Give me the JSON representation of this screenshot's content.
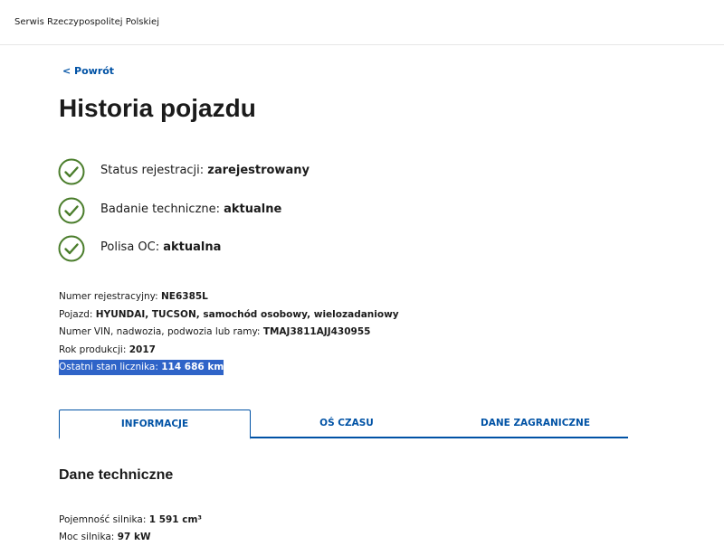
{
  "header": {
    "site_name": "Serwis Rzeczypospolitej Polskiej"
  },
  "nav": {
    "back_label": "< Powrót"
  },
  "page": {
    "title": "Historia pojazdu"
  },
  "statuses": [
    {
      "label": "Status rejestracji: ",
      "value": "zarejestrowany",
      "icon": "check-circle-icon"
    },
    {
      "label": "Badanie techniczne: ",
      "value": "aktualne",
      "icon": "check-circle-icon"
    },
    {
      "label": "Polisa OC: ",
      "value": "aktualna",
      "icon": "check-circle-icon"
    }
  ],
  "details": {
    "registration": {
      "label": "Numer rejestracyjny: ",
      "value": "NE6385L"
    },
    "vehicle": {
      "label": "Pojazd: ",
      "value": "HYUNDAI, TUCSON, samochód osobowy, wielozadaniowy"
    },
    "vin": {
      "label": "Numer VIN, nadwozia, podwozia lub ramy: ",
      "value": "TMAJ3811AJJ430955"
    },
    "year": {
      "label": "Rok produkcji: ",
      "value": "2017"
    },
    "odometer": {
      "label": "Ostatni stan licznika: ",
      "value": "114 686 km"
    }
  },
  "tabs": [
    {
      "label": "INFORMACJE",
      "active": true
    },
    {
      "label": "OŚ CZASU",
      "active": false
    },
    {
      "label": "DANE ZAGRANICZNE",
      "active": false
    }
  ],
  "section": {
    "title": "Dane techniczne"
  },
  "technical": {
    "engine_capacity": {
      "label": "Pojemność silnika: ",
      "value": "1 591 cm³"
    },
    "engine_power": {
      "label": "Moc silnika: ",
      "value": "97 kW"
    }
  },
  "colors": {
    "accent": "#0052a5",
    "check": "#4a7d2b",
    "highlight": "#2f64c8"
  }
}
